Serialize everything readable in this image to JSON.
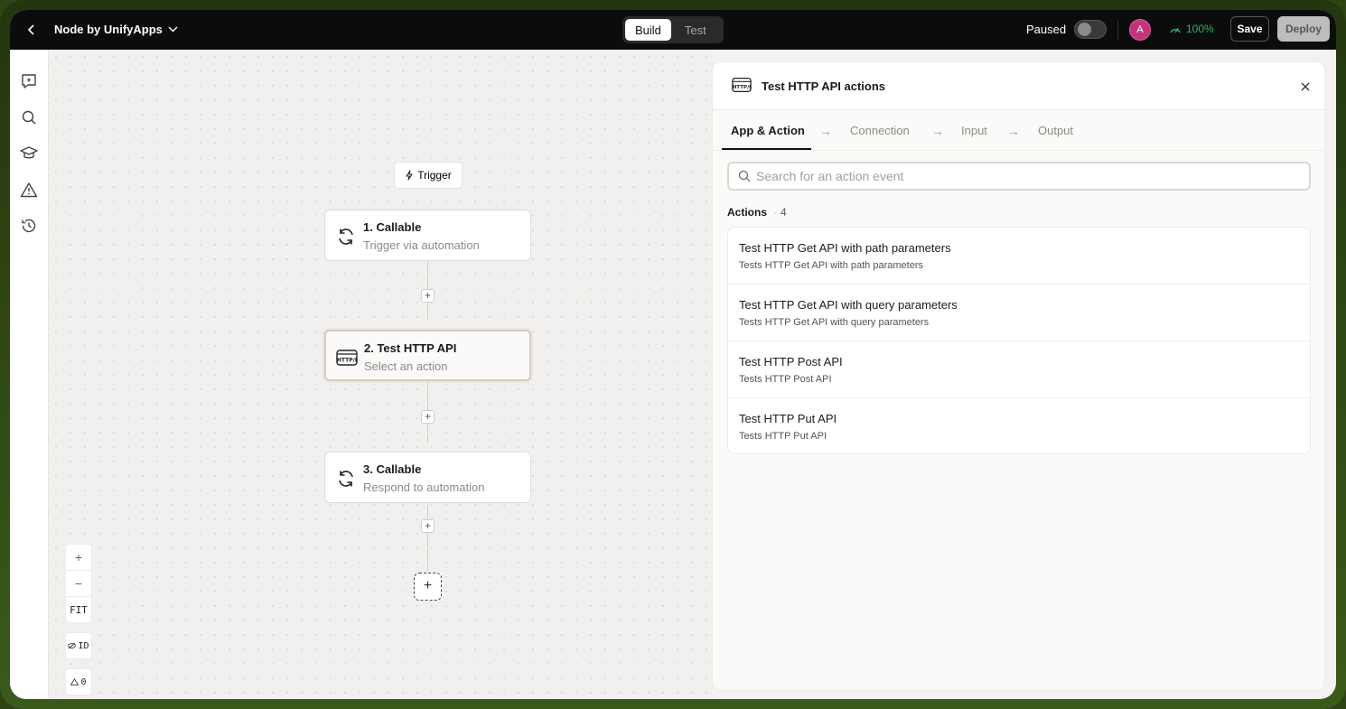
{
  "header": {
    "app_name": "Node by UnifyApps",
    "modes": [
      "Build",
      "Test"
    ],
    "active_mode": "Build",
    "status_label": "Paused",
    "avatar_initial": "A",
    "health_value": "100%",
    "save_label": "Save",
    "deploy_label": "Deploy"
  },
  "canvas": {
    "trigger_label": "Trigger",
    "nodes": [
      {
        "title": "1. Callable",
        "subtitle": "Trigger via automation",
        "icon": "refresh-icon"
      },
      {
        "title": "2. Test HTTP API",
        "subtitle": "Select an action",
        "icon": "http-api-icon"
      },
      {
        "title": "3. Callable",
        "subtitle": "Respond to automation",
        "icon": "refresh-icon"
      }
    ],
    "zoom_in": "+",
    "zoom_out": "−",
    "fit_label": "FIT",
    "id_label": "ID",
    "warning_count": "0"
  },
  "panel": {
    "title": "Test HTTP API actions",
    "steps": [
      "App & Action",
      "Connection",
      "Input",
      "Output"
    ],
    "active_step": "App & Action",
    "search_placeholder": "Search for an action event",
    "actions_label": "Actions",
    "actions_count": "4",
    "actions": [
      {
        "title": "Test HTTP Get API with path parameters",
        "description": "Tests HTTP Get API with path parameters"
      },
      {
        "title": "Test HTTP Get API with query parameters",
        "description": "Tests HTTP Get API with query parameters"
      },
      {
        "title": "Test HTTP Post API",
        "description": "Tests HTTP Post API"
      },
      {
        "title": "Test HTTP Put API",
        "description": "Tests HTTP Put API"
      }
    ]
  },
  "colors": {
    "accent_dark": "#0c0c0c",
    "health_green": "#2db36c",
    "avatar_pink": "#c2357a"
  }
}
